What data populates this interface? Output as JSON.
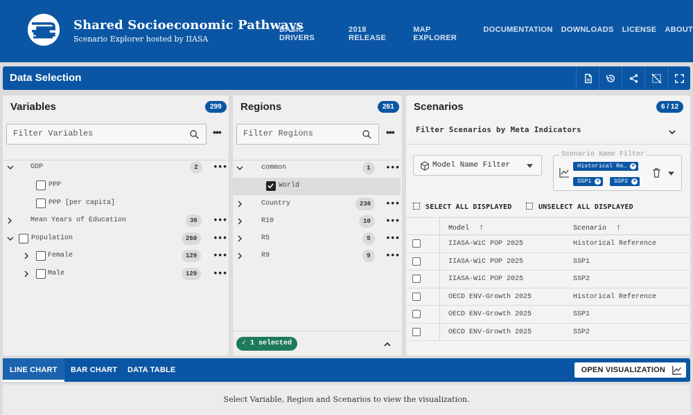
{
  "header": {
    "title": "Shared Socioeconomic Pathways",
    "subtitle": "Scenario Explorer hosted by IIASA",
    "nav": [
      "BASIC DRIVERS",
      "2018 RELEASE",
      "MAP EXPLORER",
      "DOCUMENTATION",
      "DOWNLOADS",
      "LICENSE",
      "ABOUT"
    ],
    "brand_color": "#0b56a4"
  },
  "data_selection": {
    "title": "Data Selection",
    "actions": [
      "file-icon",
      "history-icon",
      "share-icon",
      "select-off-icon",
      "fullscreen-icon"
    ]
  },
  "variables": {
    "title": "Variables",
    "count": "299",
    "filter_placeholder": "Filter Variables",
    "tree": [
      {
        "label": "GDP",
        "count": "2",
        "expanded": true
      },
      {
        "label": "PPP",
        "checked": false
      },
      {
        "label": "PPP [per capita]",
        "checked": false
      },
      {
        "label": "Mean Years of Education",
        "count": "36",
        "expanded": false
      },
      {
        "label": "Population",
        "count": "260",
        "expanded": true,
        "checked": false
      },
      {
        "label": "Female",
        "count": "129",
        "expanded": false,
        "checked": false
      },
      {
        "label": "Male",
        "count": "129",
        "expanded": false,
        "checked": false
      }
    ]
  },
  "regions": {
    "title": "Regions",
    "count": "261",
    "filter_placeholder": "Filter Regions",
    "tree": [
      {
        "label": "common",
        "count": "1",
        "expanded": true
      },
      {
        "label": "World",
        "checked": true
      },
      {
        "label": "Country",
        "count": "236",
        "expanded": false
      },
      {
        "label": "R10",
        "count": "10",
        "expanded": false
      },
      {
        "label": "R5",
        "count": "5",
        "expanded": false
      },
      {
        "label": "R9",
        "count": "9",
        "expanded": false
      }
    ],
    "selected_text": "1 selected"
  },
  "scenarios": {
    "title": "Scenarios",
    "count": "6 / 12",
    "meta_filter": "Filter Scenarios by Meta Indicators",
    "model_filter": "Model Name Filter",
    "scenario_filter_legend": "Scenario Name Filter",
    "chips": [
      "Historical Re…",
      "SSP1",
      "SSP2"
    ],
    "select_all": "SELECT ALL DISPLAYED",
    "unselect_all": "UNSELECT ALL DISPLAYED",
    "columns": [
      "Model",
      "Scenario"
    ],
    "rows": [
      {
        "model": "IIASA-WiC POP 2025",
        "scenario": "Historical Reference"
      },
      {
        "model": "IIASA-WiC POP 2025",
        "scenario": "SSP1"
      },
      {
        "model": "IIASA-WiC POP 2025",
        "scenario": "SSP2"
      },
      {
        "model": "OECD ENV-Growth 2025",
        "scenario": "Historical Reference"
      },
      {
        "model": "OECD ENV-Growth 2025",
        "scenario": "SSP1"
      },
      {
        "model": "OECD ENV-Growth 2025",
        "scenario": "SSP2"
      }
    ]
  },
  "visualization": {
    "tabs": [
      "LINE CHART",
      "BAR CHART",
      "DATA TABLE"
    ],
    "active_tab": "LINE CHART",
    "open_button": "OPEN VISUALIZATION",
    "message": "Select Variable, Region and Scenarios to view the visualization."
  }
}
